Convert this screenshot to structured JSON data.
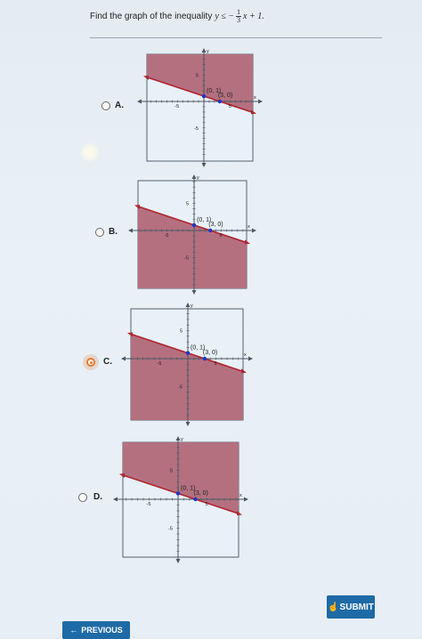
{
  "question": {
    "prefix": "Find the graph of the inequality",
    "lhs": "y ≤ −",
    "frac_num": "1",
    "frac_den": "3",
    "rhs": "x + 1."
  },
  "graph_labels": {
    "point_a": "(0, 1)",
    "point_b": "(3, 0)",
    "tick_pos": "5",
    "tick_neg": "-5",
    "x_axis": "x",
    "y_axis": "y"
  },
  "options": [
    {
      "letter": "A.",
      "selected": false,
      "shade": "above"
    },
    {
      "letter": "B.",
      "selected": false,
      "shade": "below"
    },
    {
      "letter": "C.",
      "selected": true,
      "shade": "below"
    },
    {
      "letter": "D.",
      "selected": false,
      "shade": "above"
    }
  ],
  "colors": {
    "shade": "#b4707f",
    "boundary": "#b0232f",
    "point": "#1a36c8",
    "selected": "#e07a32",
    "button": "#1d6aa6"
  },
  "buttons": {
    "submit": "SUBMIT",
    "previous": "PREVIOUS"
  },
  "icons": {
    "submit_cursor": "hand-cursor-icon",
    "previous_arrow": "left-arrow-icon"
  }
}
